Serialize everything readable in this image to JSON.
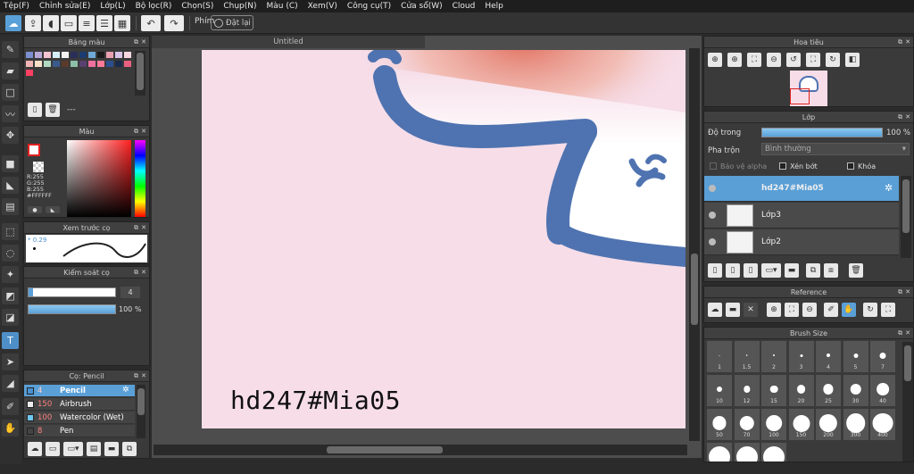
{
  "menu": [
    "Tệp(F)",
    "Chỉnh sửa(E)",
    "Lớp(L)",
    "Bộ lọc(R)",
    "Chọn(S)",
    "Chụp(N)",
    "Màu (C)",
    "Xem(V)",
    "Công cụ(T)",
    "Cửa sổ(W)",
    "Cloud",
    "Help"
  ],
  "toolbar": {
    "phim_label": "Phím",
    "reset_label": "Đặt lại"
  },
  "document": {
    "tab_title": "Untitled",
    "watermark": "hd247#Mia05"
  },
  "palette_panel": {
    "title": "Bảng màu",
    "footer_text": "---",
    "swatches": [
      "#7c8fd0",
      "#b8a8d8",
      "#f4c2d0",
      "#d6eef6",
      "#f2f2f2",
      "#2a2f5a",
      "#1b3c70",
      "#6ea8d6",
      "#1a1a1a",
      "#e9a0b0",
      "#d8c6e8",
      "#f8d8e0",
      "#f0b4b4",
      "#f8e0c8",
      "#b0d8c0",
      "#3a5a8c",
      "#5a3a2a",
      "#8cc0a8",
      "#5a4070",
      "#f070a0",
      "#ff7a9a",
      "#2a5090",
      "#1a2a4a",
      "#e86080",
      "#ff4060"
    ]
  },
  "color_panel": {
    "title": "Màu",
    "primary": "#ffffff",
    "readout": {
      "r": "R:255",
      "g": "G:255",
      "b": "B:255",
      "hex": "#FFFFFF"
    }
  },
  "preview_panel": {
    "title": "Xem trước cọ",
    "size_label": "* 0.29"
  },
  "control_panel": {
    "title": "Kiểm soát cọ",
    "size_value": "4",
    "opacity_value": "100 %"
  },
  "brush_panel": {
    "title": "Cọ: Pencil",
    "brushes": [
      {
        "size": "4",
        "name": "Pencil",
        "color": "#4a90d0",
        "selected": true
      },
      {
        "size": "150",
        "name": "Airbrush",
        "color": "#eeeeee",
        "selected": false
      },
      {
        "size": "100",
        "name": "Watercolor (Wet)",
        "color": "#6ec8f0",
        "selected": false
      },
      {
        "size": "8",
        "name": "Pen",
        "color": "#444444",
        "selected": false
      }
    ]
  },
  "navigator_panel": {
    "title": "Hoa tiêu"
  },
  "layer_panel": {
    "title": "Lớp",
    "opacity_label": "Độ trong",
    "opacity_value": "100 %",
    "blend_label": "Pha trộn",
    "blend_value": "Bình thường",
    "protect_alpha": "Bảo vệ alpha",
    "clipping": "Xén bớt",
    "lock": "Khóa",
    "layers": [
      {
        "name": "hd247#Mia05",
        "selected": true
      },
      {
        "name": "Lớp3",
        "selected": false
      },
      {
        "name": "Lớp2",
        "selected": false
      }
    ]
  },
  "reference_panel": {
    "title": "Reference"
  },
  "brushsize_panel": {
    "title": "Brush Size",
    "sizes": [
      "1",
      "1.5",
      "2",
      "3",
      "4",
      "5",
      "7",
      "10",
      "12",
      "15",
      "20",
      "25",
      "30",
      "40",
      "50",
      "70",
      "100",
      "150",
      "200",
      "300",
      "400",
      "",
      "",
      ""
    ]
  },
  "colors": {
    "accent": "#5a9fd6",
    "canvas_bg": "#f6dde8",
    "stroke": "#4f73b0"
  }
}
